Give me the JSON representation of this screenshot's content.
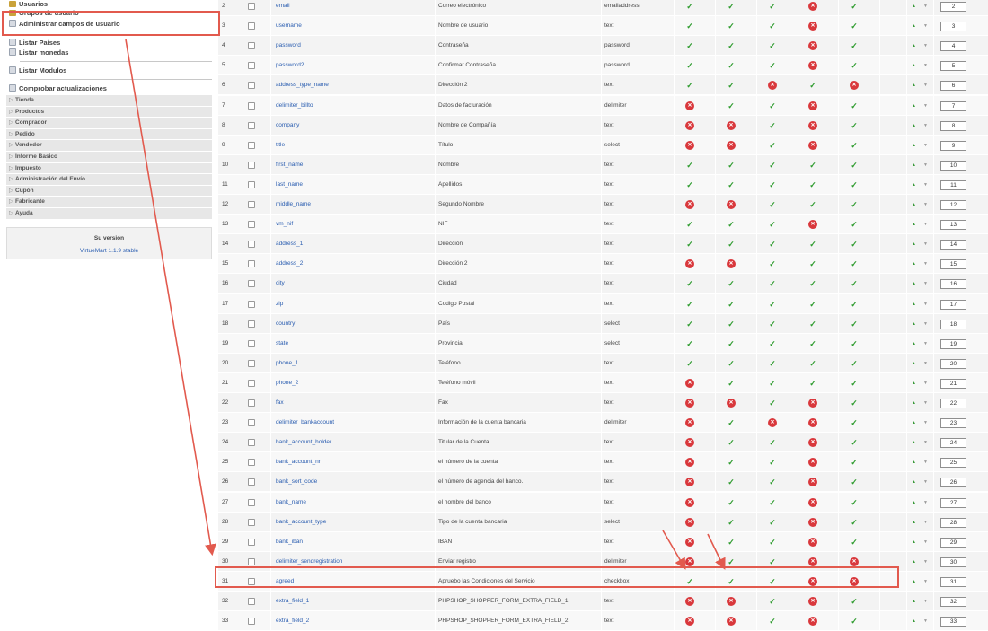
{
  "sidebar": {
    "items": [
      {
        "label": "Usuarios",
        "icon": "users-icon"
      },
      {
        "label": "Grupos de usuario",
        "icon": "users-icon"
      },
      {
        "label": "Administrar campos de usuario",
        "icon": "page-icon"
      },
      {
        "label": "Listar Países",
        "icon": "page-icon"
      },
      {
        "label": "Listar monedas",
        "icon": "page-icon"
      },
      {
        "label": "Listar Modulos",
        "icon": "page-icon"
      },
      {
        "label": "Comprobar actualizaciones",
        "icon": "page-icon"
      }
    ],
    "categories": [
      "Tienda",
      "Productos",
      "Comprador",
      "Pedido",
      "Vendedor",
      "Informe Basico",
      "Impuesto",
      "Administración del Envío",
      "Cupón",
      "Fabricante",
      "Ayuda"
    ],
    "version_label": "Su versión",
    "version_link": "VirtueMart 1.1.9 stable"
  },
  "colors": {
    "accent": "#e25a4e",
    "link": "#2a5db0",
    "ok": "#2e9b2e",
    "no": "#d9383c"
  },
  "icons": {
    "ok": "✓",
    "no": "✕",
    "up": "▲",
    "down": "▼"
  },
  "table": {
    "rows": [
      {
        "n": "2",
        "name": "email",
        "title": "Correo electrónico",
        "type": "emailaddress",
        "f": [
          1,
          1,
          1,
          0,
          1
        ],
        "order": "2"
      },
      {
        "n": "3",
        "name": "username",
        "title": "Nombre de usuario",
        "type": "text",
        "f": [
          1,
          1,
          1,
          0,
          1
        ],
        "order": "3"
      },
      {
        "n": "4",
        "name": "password",
        "title": "Contraseña",
        "type": "password",
        "f": [
          1,
          1,
          1,
          0,
          1
        ],
        "order": "4"
      },
      {
        "n": "5",
        "name": "password2",
        "title": "Confirmar Contraseña",
        "type": "password",
        "f": [
          1,
          1,
          1,
          0,
          1
        ],
        "order": "5"
      },
      {
        "n": "6",
        "name": "address_type_name",
        "title": "Dirección 2",
        "type": "text",
        "f": [
          1,
          1,
          0,
          1,
          0
        ],
        "order": "6"
      },
      {
        "n": "7",
        "name": "delimiter_billto",
        "title": "Datos de facturación",
        "type": "delimiter",
        "f": [
          0,
          1,
          1,
          0,
          1
        ],
        "order": "7"
      },
      {
        "n": "8",
        "name": "company",
        "title": "Nombre de Compañía",
        "type": "text",
        "f": [
          0,
          0,
          1,
          0,
          1
        ],
        "order": "8"
      },
      {
        "n": "9",
        "name": "title",
        "title": "Título",
        "type": "select",
        "f": [
          0,
          0,
          1,
          0,
          1
        ],
        "order": "9"
      },
      {
        "n": "10",
        "name": "first_name",
        "title": "Nombre",
        "type": "text",
        "f": [
          1,
          1,
          1,
          1,
          1
        ],
        "order": "10"
      },
      {
        "n": "11",
        "name": "last_name",
        "title": "Apellidos",
        "type": "text",
        "f": [
          1,
          1,
          1,
          1,
          1
        ],
        "order": "11"
      },
      {
        "n": "12",
        "name": "middle_name",
        "title": "Segundo Nombre",
        "type": "text",
        "f": [
          0,
          0,
          1,
          1,
          1
        ],
        "order": "12"
      },
      {
        "n": "13",
        "name": "vm_nif",
        "title": "NIF",
        "type": "text",
        "f": [
          1,
          1,
          1,
          0,
          1
        ],
        "order": "13"
      },
      {
        "n": "14",
        "name": "address_1",
        "title": "Dirección",
        "type": "text",
        "f": [
          1,
          1,
          1,
          1,
          1
        ],
        "order": "14"
      },
      {
        "n": "15",
        "name": "address_2",
        "title": "Dirección 2",
        "type": "text",
        "f": [
          0,
          0,
          1,
          1,
          1
        ],
        "order": "15"
      },
      {
        "n": "16",
        "name": "city",
        "title": "Ciudad",
        "type": "text",
        "f": [
          1,
          1,
          1,
          1,
          1
        ],
        "order": "16"
      },
      {
        "n": "17",
        "name": "zip",
        "title": "Codigo Postal",
        "type": "text",
        "f": [
          1,
          1,
          1,
          1,
          1
        ],
        "order": "17"
      },
      {
        "n": "18",
        "name": "country",
        "title": "País",
        "type": "select",
        "f": [
          1,
          1,
          1,
          1,
          1
        ],
        "order": "18"
      },
      {
        "n": "19",
        "name": "state",
        "title": "Provincia",
        "type": "select",
        "f": [
          1,
          1,
          1,
          1,
          1
        ],
        "order": "19"
      },
      {
        "n": "20",
        "name": "phone_1",
        "title": "Teléfono",
        "type": "text",
        "f": [
          1,
          1,
          1,
          1,
          1
        ],
        "order": "20"
      },
      {
        "n": "21",
        "name": "phone_2",
        "title": "Teléfono móvil",
        "type": "text",
        "f": [
          0,
          1,
          1,
          1,
          1
        ],
        "order": "21"
      },
      {
        "n": "22",
        "name": "fax",
        "title": "Fax",
        "type": "text",
        "f": [
          0,
          0,
          1,
          0,
          1
        ],
        "order": "22"
      },
      {
        "n": "23",
        "name": "delimiter_bankaccount",
        "title": "Información de la cuenta bancaria",
        "type": "delimiter",
        "f": [
          0,
          1,
          0,
          0,
          1
        ],
        "order": "23"
      },
      {
        "n": "24",
        "name": "bank_account_holder",
        "title": "Titular de la Cuenta",
        "type": "text",
        "f": [
          0,
          1,
          1,
          0,
          1
        ],
        "order": "24"
      },
      {
        "n": "25",
        "name": "bank_account_nr",
        "title": "el número de la cuenta",
        "type": "text",
        "f": [
          0,
          1,
          1,
          0,
          1
        ],
        "order": "25"
      },
      {
        "n": "26",
        "name": "bank_sort_code",
        "title": "el número de agencia del banco.",
        "type": "text",
        "f": [
          0,
          1,
          1,
          0,
          1
        ],
        "order": "26"
      },
      {
        "n": "27",
        "name": "bank_name",
        "title": "el nombre del banco",
        "type": "text",
        "f": [
          0,
          1,
          1,
          0,
          1
        ],
        "order": "27"
      },
      {
        "n": "28",
        "name": "bank_account_type",
        "title": "Tipo de la cuenta bancaria",
        "type": "select",
        "f": [
          0,
          1,
          1,
          0,
          1
        ],
        "order": "28"
      },
      {
        "n": "29",
        "name": "bank_iban",
        "title": "IBAN",
        "type": "text",
        "f": [
          0,
          1,
          1,
          0,
          1
        ],
        "order": "29"
      },
      {
        "n": "30",
        "name": "delimiter_sendregistration",
        "title": "Enviar registro",
        "type": "delimiter",
        "f": [
          0,
          1,
          1,
          0,
          0
        ],
        "order": "30"
      },
      {
        "n": "31",
        "name": "agreed",
        "title": "Apruebo las Condiciones del Servicio",
        "type": "checkbox",
        "f": [
          1,
          1,
          1,
          0,
          0
        ],
        "order": "31"
      },
      {
        "n": "32",
        "name": "extra_field_1",
        "title": "PHPSHOP_SHOPPER_FORM_EXTRA_FIELD_1",
        "type": "text",
        "f": [
          0,
          0,
          1,
          0,
          1
        ],
        "order": "32"
      },
      {
        "n": "33",
        "name": "extra_field_2",
        "title": "PHPSHOP_SHOPPER_FORM_EXTRA_FIELD_2",
        "type": "text",
        "f": [
          0,
          0,
          1,
          0,
          1
        ],
        "order": "33"
      }
    ]
  }
}
